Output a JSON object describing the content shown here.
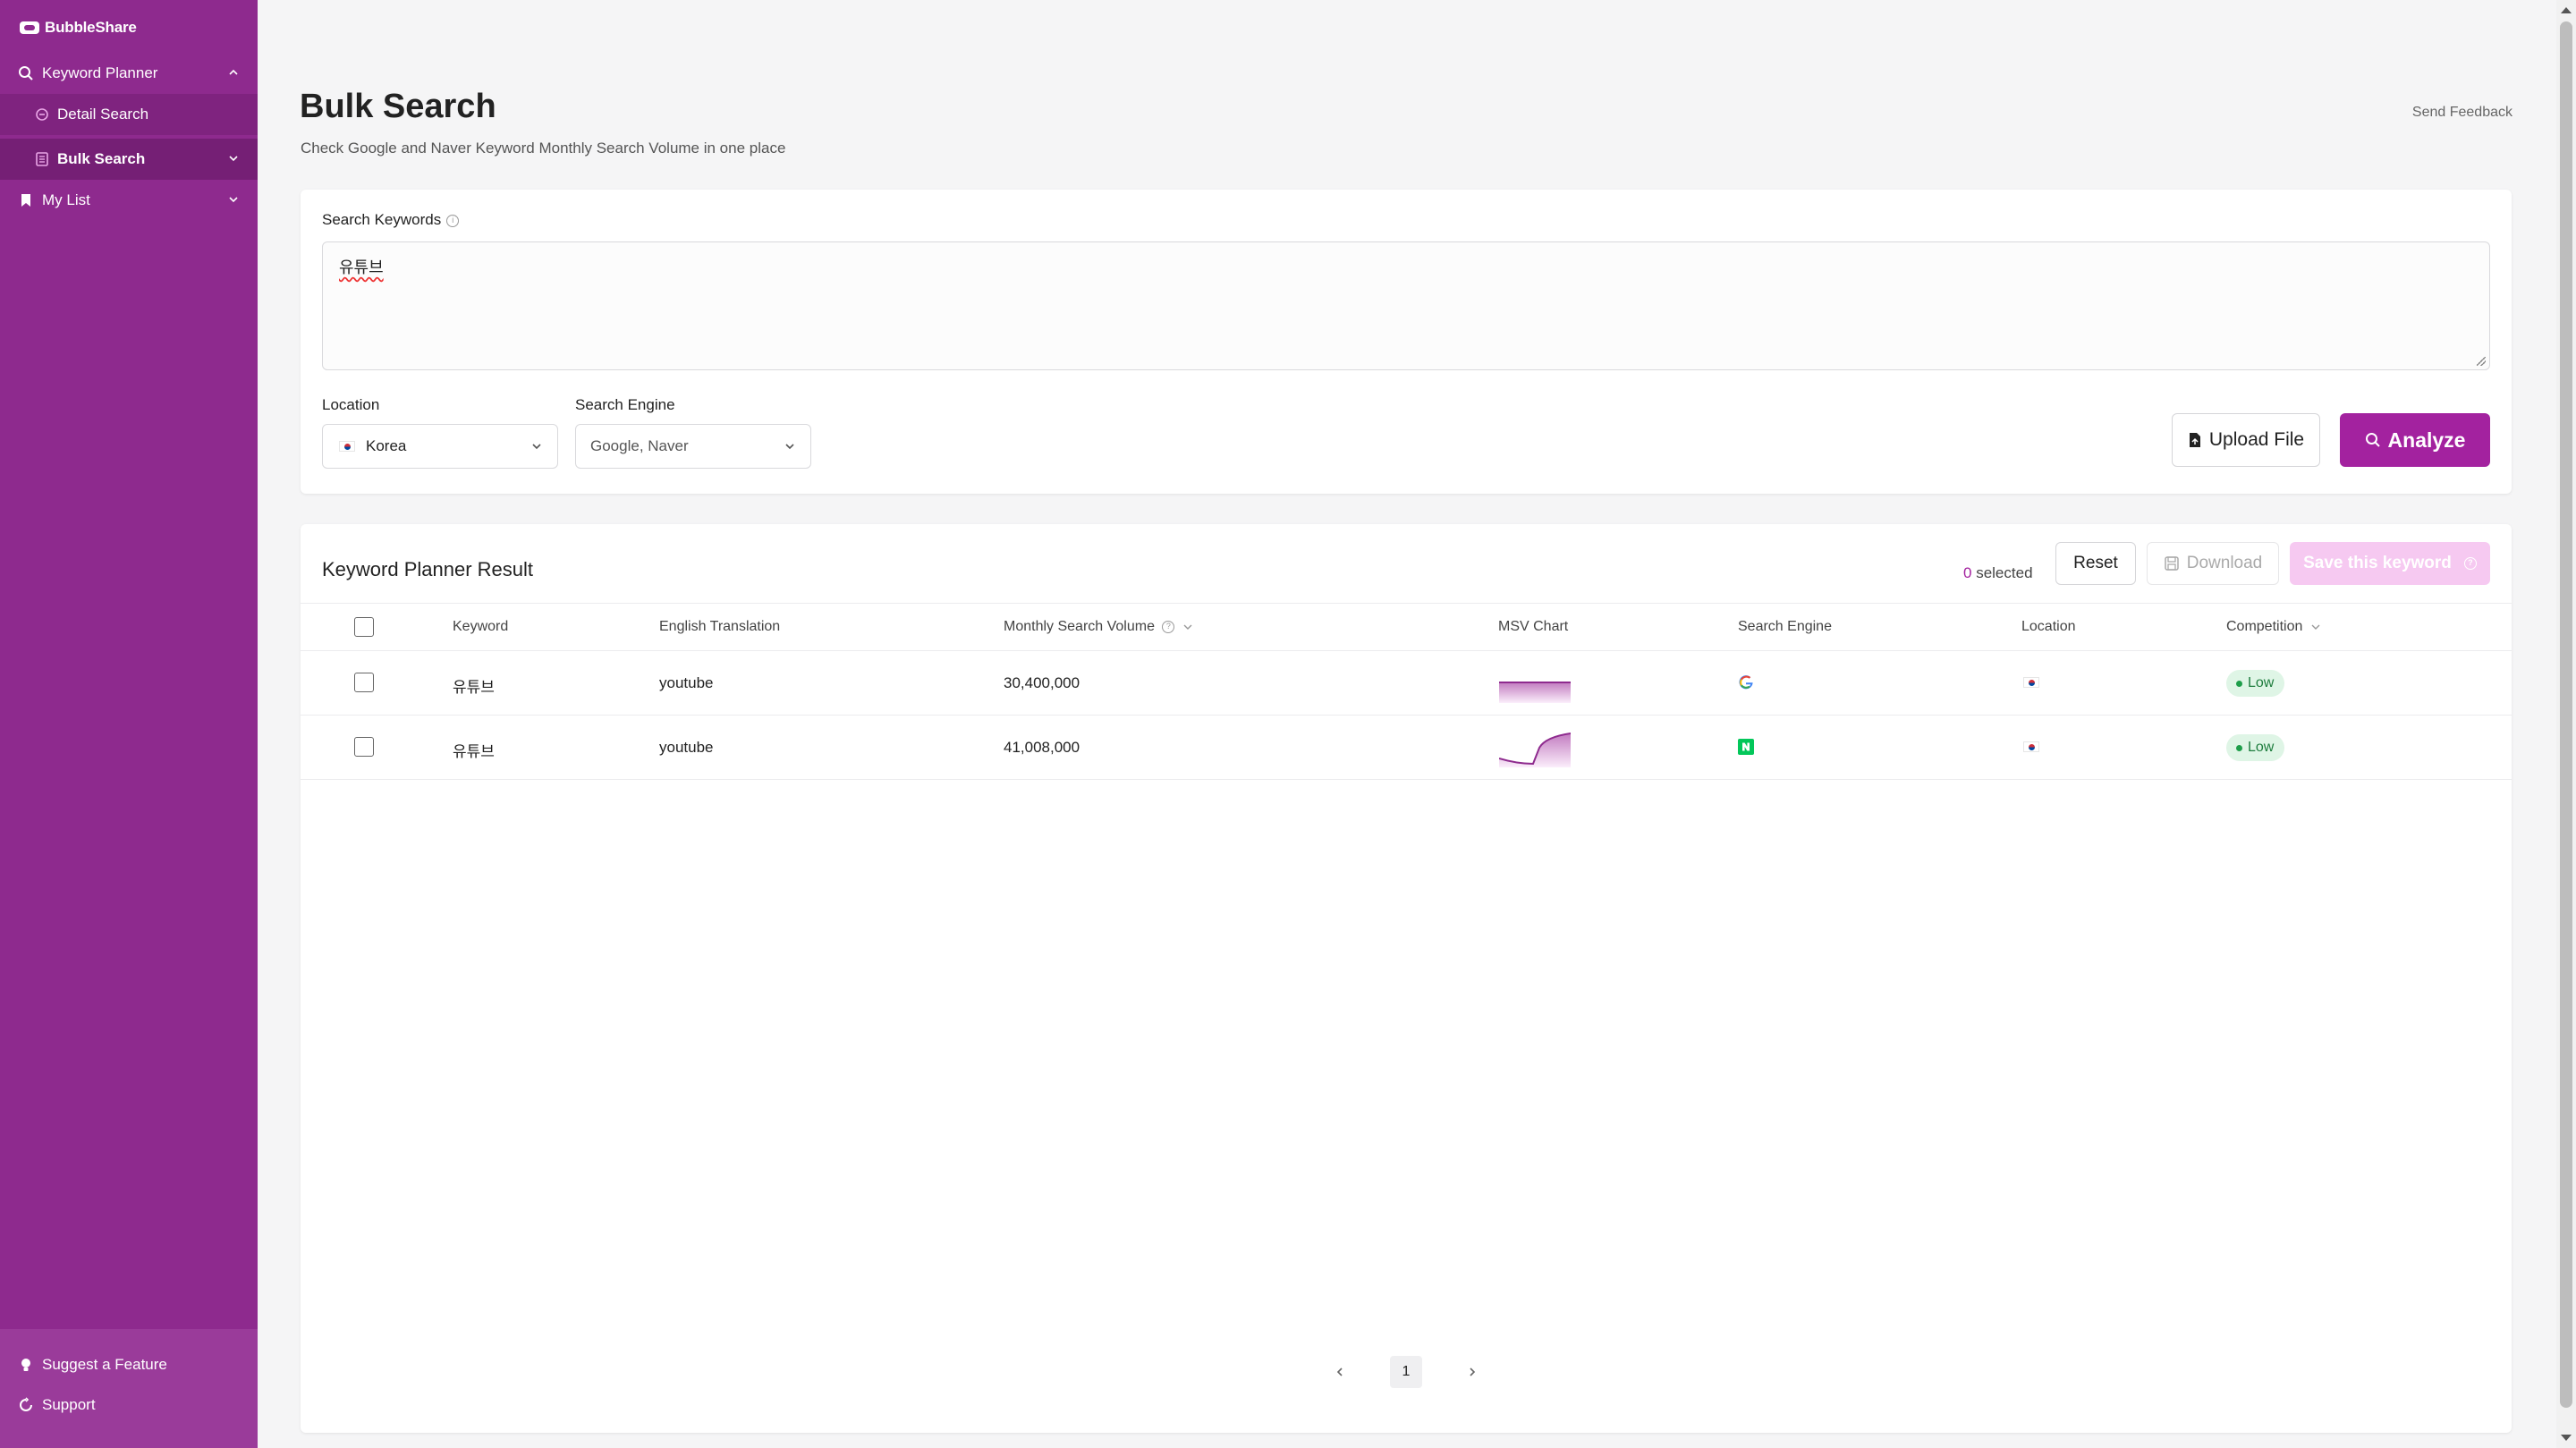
{
  "brand": {
    "name": "BubbleShare"
  },
  "sidebar": {
    "items": [
      {
        "label": "Keyword Planner"
      },
      {
        "label": "Detail Search"
      },
      {
        "label": "Bulk Search"
      },
      {
        "label": "My List"
      }
    ],
    "footer": [
      {
        "label": "Suggest a Feature"
      },
      {
        "label": "Support"
      }
    ]
  },
  "header": {
    "title": "Bulk Search",
    "subtitle": "Check Google and Naver Keyword Monthly Search Volume in one place",
    "feedback": "Send Feedback"
  },
  "search": {
    "keywords_label": "Search Keywords",
    "keywords_value": "유튜브",
    "location_label": "Location",
    "location_value": "Korea",
    "engine_label": "Search Engine",
    "engine_value": "Google, Naver",
    "upload_label": "Upload File",
    "analyze_label": "Analyze"
  },
  "result": {
    "title": "Keyword Planner Result",
    "selected_count": "0",
    "selected_suffix": "selected",
    "reset_label": "Reset",
    "download_label": "Download",
    "save_label": "Save this keyword",
    "columns": [
      "Keyword",
      "English Translation",
      "Monthly Search Volume",
      "MSV Chart",
      "Search Engine",
      "Location",
      "Competition"
    ],
    "rows": [
      {
        "keyword": "유튜브",
        "translation": "youtube",
        "volume": "30,400,000",
        "engine": "Google",
        "location": "Korea",
        "competition": "Low"
      },
      {
        "keyword": "유튜브",
        "translation": "youtube",
        "volume": "41,008,000",
        "engine": "Naver",
        "location": "Korea",
        "competition": "Low"
      }
    ],
    "page": "1"
  },
  "colors": {
    "sidebar": "#8e2a8e",
    "primary": "#a3229f",
    "badge_low_bg": "#dff5e6",
    "badge_low_text": "#1e7d3e"
  }
}
